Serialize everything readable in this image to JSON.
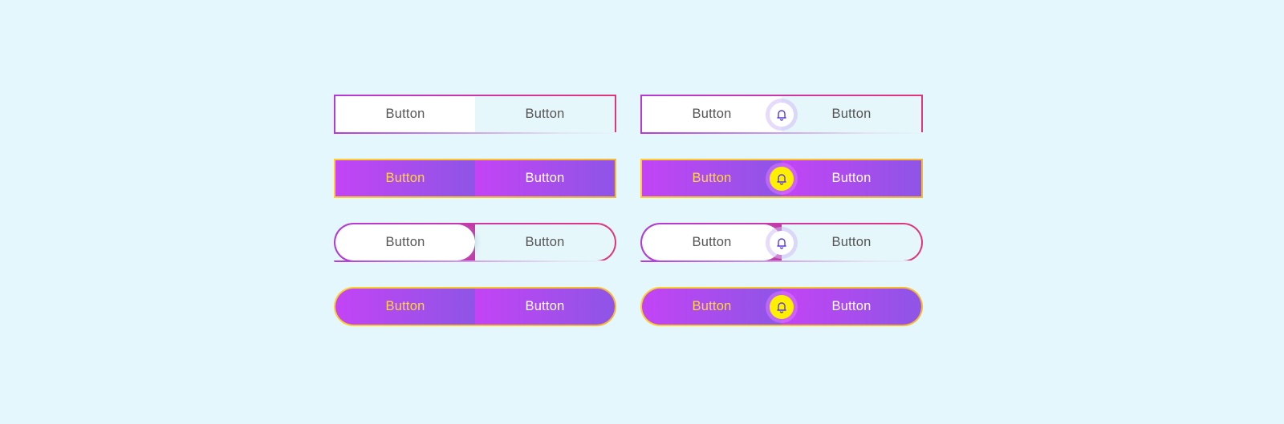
{
  "groups": {
    "left": [
      {
        "first": "Button",
        "second": "Button"
      },
      {
        "first": "Button",
        "second": "Button"
      },
      {
        "first": "Button",
        "second": "Button"
      },
      {
        "first": "Button",
        "second": "Button"
      }
    ],
    "right": [
      {
        "first": "Button",
        "second": "Button",
        "icon": "bell-icon"
      },
      {
        "first": "Button",
        "second": "Button",
        "icon": "bell-icon"
      },
      {
        "first": "Button",
        "second": "Button",
        "icon": "bell-icon"
      },
      {
        "first": "Button",
        "second": "Button",
        "icon": "bell-icon"
      }
    ]
  },
  "colors": {
    "background": "#e3f7fd",
    "light_border_start": "#b23ad8",
    "light_border_end": "#e0357a",
    "dark_fill_start": "#c344f5",
    "dark_fill_end": "#8e55e6",
    "dark_border": "#ffd02a",
    "accent_yellow_text": "#ffd83a",
    "bell_yellow": "#ffef00",
    "bell_stroke": "#5a3ae0"
  }
}
